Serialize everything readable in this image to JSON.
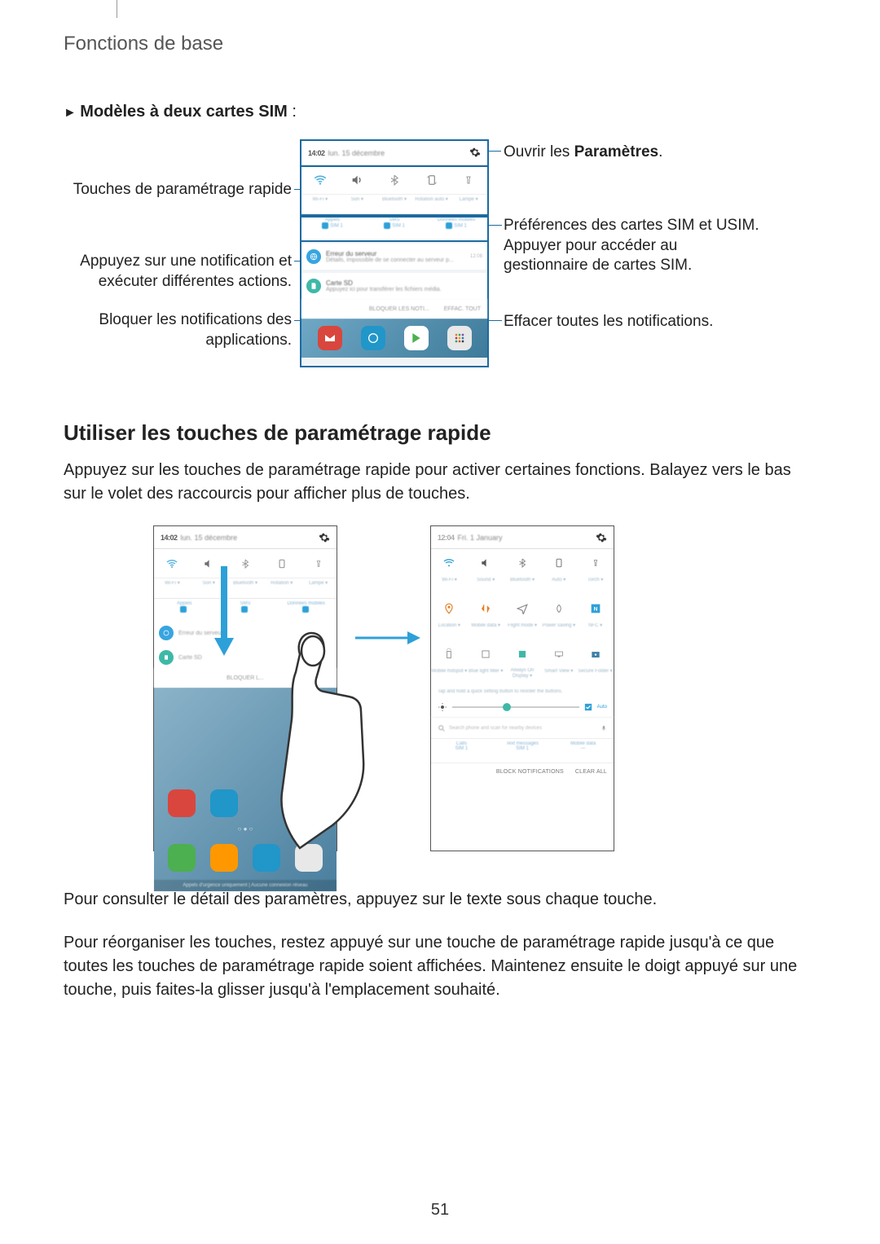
{
  "header": "Fonctions de base",
  "subheader_prefix": "► ",
  "subheader_bold": "Modèles à deux cartes SIM",
  "subheader_suffix": " :",
  "callouts": {
    "l1": "Touches de paramétrage rapide",
    "l2a": "Appuyez sur une notification et",
    "l2b": "exécuter différentes actions.",
    "l3a": "Bloquer les notifications des",
    "l3b": "applications.",
    "r1_pre": "Ouvrir les ",
    "r1_bold": "Paramètres",
    "r1_post": ".",
    "r2a": "Préférences des cartes SIM et USIM.",
    "r2b": "Appuyer pour accéder au",
    "r2c": "gestionnaire de cartes SIM.",
    "r3": "Effacer toutes les notifications."
  },
  "phone1": {
    "time": "14:02",
    "date": "lun. 15 décembre",
    "qs_labels": [
      "Wi-Fi ▾",
      "Son ▾",
      "Bluetooth ▾",
      "Rotation auto ▾",
      "Lampe ▾"
    ],
    "sim_titles": [
      "Appels",
      "SMS",
      "Données mobiles"
    ],
    "sim_values": [
      "SIM 1",
      "SIM 1",
      "SIM 1"
    ],
    "notif1_title": "Erreur du serveur",
    "notif1_body": "Détails, impossible de se connecter au serveur p...",
    "notif1_time": "12:08",
    "notif2_title": "Carte SD",
    "notif2_body": "Appuyez ici pour transférer les fichiers média.",
    "actions": [
      "BLOQUER LES NOTI...",
      "EFFAC. TOUT"
    ]
  },
  "section_h2": "Utiliser les touches de paramétrage rapide",
  "para1": "Appuyez sur les touches de paramétrage rapide pour activer certaines fonctions. Balayez vers le bas sur le volet des raccourcis pour afficher plus de touches.",
  "phone2left": {
    "time": "14:02",
    "date": "lun. 15 décembre",
    "qs_labels": [
      "Wi-Fi ▾",
      "Son ▾",
      "Bluetooth ▾",
      "Rotation ▾",
      "Lampe ▾"
    ],
    "sim_titles": [
      "Appels",
      "SMS",
      "Données mobiles"
    ],
    "notif1_title": "Erreur du serveur",
    "notif2_title": "Carte SD",
    "action": "BLOQUER L...",
    "emergency": "Appels d'urgence uniquement | Aucune connexion réseau"
  },
  "phone2right": {
    "time": "12:04",
    "date": "Fri. 1 January",
    "row1_labels": [
      "Wi-Fi ▾",
      "Sound ▾",
      "Bluetooth ▾",
      "Auto ▾",
      "Torch ▾"
    ],
    "row2_labels": [
      "Location ▾",
      "Mobile data ▾",
      "Flight mode ▾",
      "Power saving ▾",
      "NFC ▾"
    ],
    "row3_labels": [
      "Mobile hotspot ▾",
      "Blue light filter ▾",
      "Always On Display ▾",
      "Smart View ▾",
      "Secure Folder ▾"
    ],
    "tip": "Tap and hold a quick setting button to reorder the buttons.",
    "auto": "Auto",
    "search": "Search phone and scan for nearby devices",
    "sim_titles": [
      "Calls",
      "Text messages",
      "Mobile data"
    ],
    "sim_values": [
      "SIM 1",
      "SIM 1",
      "—"
    ],
    "actions": [
      "BLOCK NOTIFICATIONS",
      "CLEAR ALL"
    ]
  },
  "para2": "Pour consulter le détail des paramètres, appuyez sur le texte sous chaque touche.",
  "para3": "Pour réorganiser les touches, restez appuyé sur une touche de paramétrage rapide jusqu'à ce que toutes les touches de paramétrage rapide soient affichées. Maintenez ensuite le doigt appuyé sur une touche, puis faites-la glisser jusqu'à l'emplacement souhaité.",
  "pagenum": "51"
}
